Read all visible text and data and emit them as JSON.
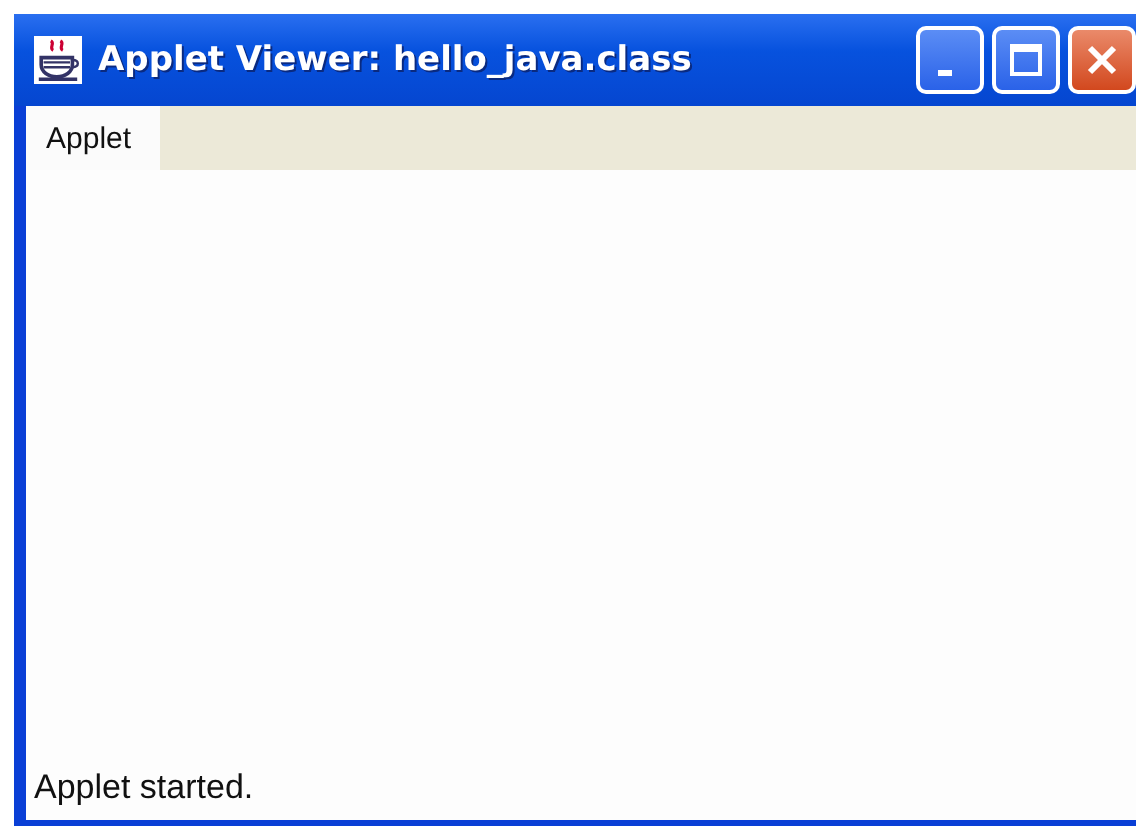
{
  "window": {
    "title": "Applet Viewer: hello_java.class"
  },
  "menu": [
    {
      "label": "Applet"
    }
  ],
  "status_bar": "Applet started."
}
